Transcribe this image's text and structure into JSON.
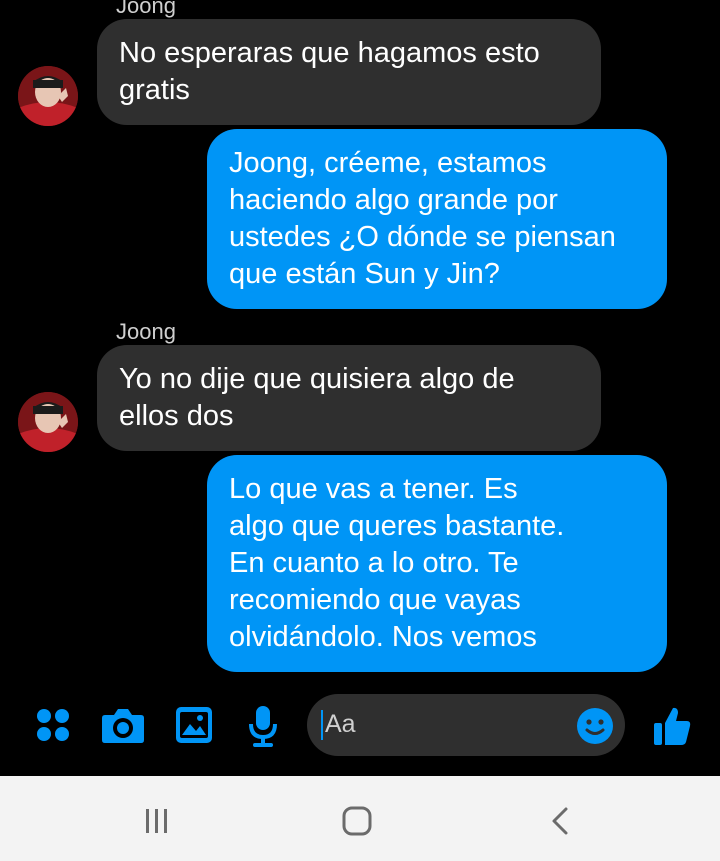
{
  "messages": [
    {
      "sender": "Joong",
      "direction": "incoming",
      "text": "No esperaras que hagamos esto\ngratis"
    },
    {
      "direction": "outgoing",
      "text": "Joong, créeme, estamos\nhaciendo algo grande por\nustedes ¿O dónde se piensan\nque están Sun y Jin?"
    },
    {
      "sender": "Joong",
      "direction": "incoming",
      "text": "Yo no dije que quisiera algo de\nellos dos"
    },
    {
      "direction": "outgoing",
      "text": "Lo que vas a tener. Es\nalgo que queres bastante.\nEn cuanto a lo otro. Te\nrecomiendo que vayas\nolvidándolo. Nos vemos"
    }
  ],
  "composer": {
    "placeholder": "Aa",
    "icons": [
      "apps-icon",
      "camera-icon",
      "gallery-icon",
      "microphone-icon",
      "emoji-icon",
      "thumbs-up-icon"
    ]
  },
  "colors": {
    "accent": "#0095f6",
    "incoming_bubble": "#2f2f2f",
    "outgoing_bubble": "#0095f6",
    "background": "#000000",
    "nav_background": "#f3f3f3"
  },
  "system_nav": [
    "recent-apps",
    "home",
    "back"
  ]
}
